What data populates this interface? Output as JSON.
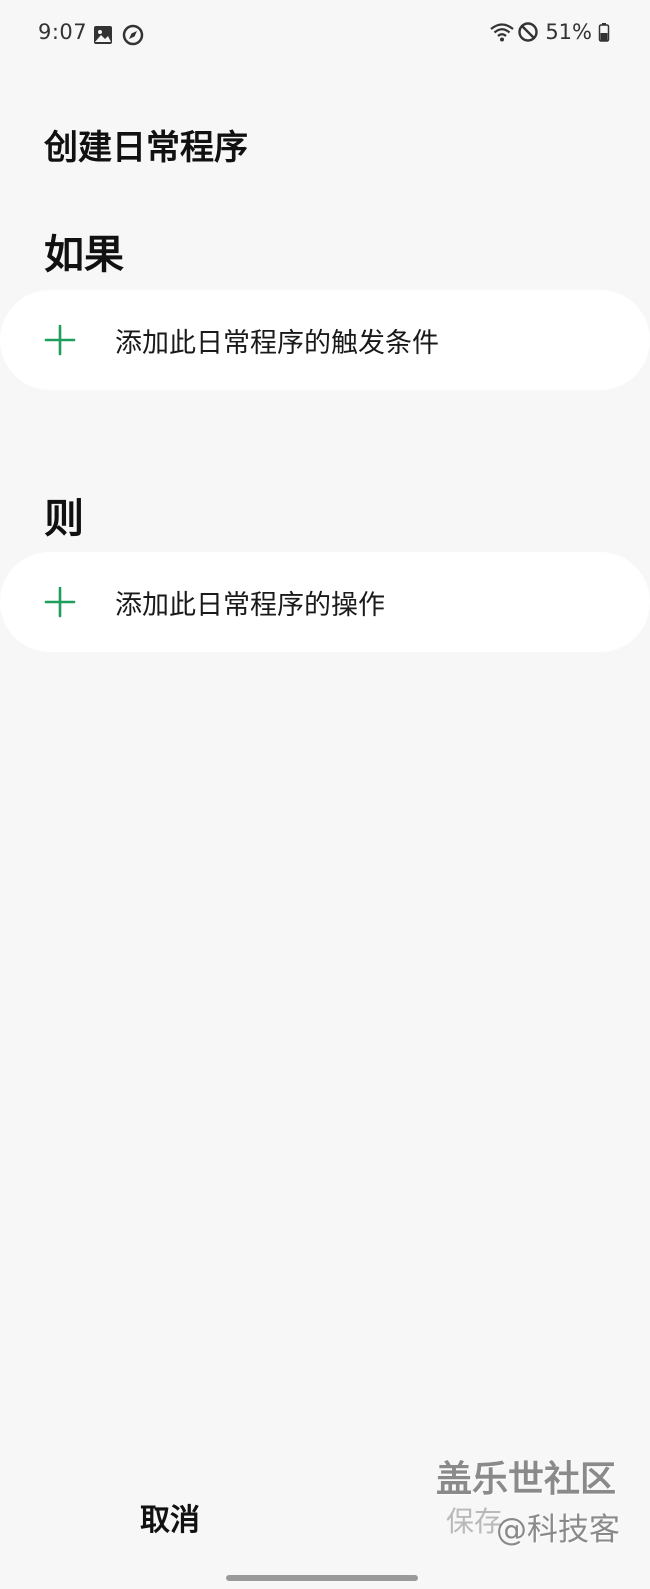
{
  "status_bar": {
    "time": "9:07",
    "left_icons": [
      "gallery-icon",
      "compass-icon"
    ],
    "right_icons": [
      "wifi-icon",
      "do-not-disturb-icon",
      "battery-icon"
    ],
    "battery": "51%"
  },
  "page": {
    "title": "创建日常程序"
  },
  "if_section": {
    "heading": "如果",
    "add_label": "添加此日常程序的触发条件"
  },
  "then_section": {
    "heading": "则",
    "add_label": "添加此日常程序的操作"
  },
  "bottom_bar": {
    "cancel_label": "取消"
  },
  "watermark": {
    "line1": "盖乐世社区",
    "save_ghost": "保存",
    "line2": "@科技客"
  },
  "colors": {
    "background": "#f7f7f7",
    "card": "#ffffff",
    "accent_green": "#1f9d5c",
    "text": "#111111"
  }
}
